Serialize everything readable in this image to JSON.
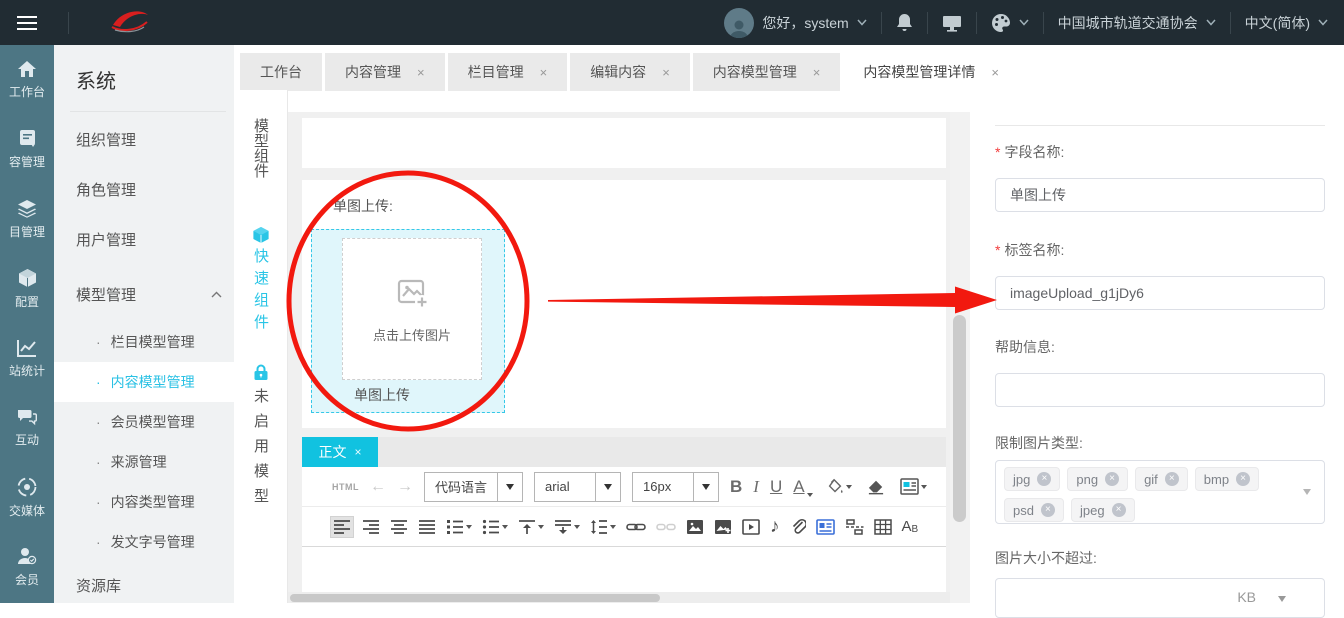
{
  "topbar": {
    "greeting": "您好，system",
    "org_name": "中国城市轨道交通协会",
    "language": "中文(简体)"
  },
  "rail": {
    "items": [
      {
        "label": "工作台",
        "icon": "home-icon"
      },
      {
        "label": "容管理",
        "icon": "document-icon"
      },
      {
        "label": "目管理",
        "icon": "layers-icon"
      },
      {
        "label": "配置",
        "icon": "cube-icon"
      },
      {
        "label": "站统计",
        "icon": "line-chart-icon"
      },
      {
        "label": "互动",
        "icon": "chat-icon"
      },
      {
        "label": "交媒体",
        "icon": "social-icon"
      },
      {
        "label": "会员",
        "icon": "member-icon"
      }
    ]
  },
  "sidebar": {
    "heading": "系统",
    "items": [
      "组织管理",
      "角色管理",
      "用户管理"
    ],
    "group": {
      "label": "模型管理",
      "expanded": true
    },
    "sub_items": [
      {
        "label": "栏目模型管理",
        "active": false
      },
      {
        "label": "内容模型管理",
        "active": true
      },
      {
        "label": "会员模型管理",
        "active": false
      },
      {
        "label": "来源管理",
        "active": false
      },
      {
        "label": "内容类型管理",
        "active": false
      },
      {
        "label": "发文字号管理",
        "active": false
      }
    ],
    "footer_item": "资源库"
  },
  "tabs": [
    {
      "label": "工作台",
      "closable": false,
      "active": false
    },
    {
      "label": "内容管理",
      "closable": true,
      "active": false
    },
    {
      "label": "栏目管理",
      "closable": true,
      "active": false
    },
    {
      "label": "编辑内容",
      "closable": true,
      "active": false
    },
    {
      "label": "内容模型管理",
      "closable": true,
      "active": false
    },
    {
      "label": "内容模型管理详情",
      "closable": true,
      "active": true
    }
  ],
  "component_rail": {
    "groups": [
      "模型组件",
      "快速组件",
      "未启用模型"
    ]
  },
  "form_canvas": {
    "field_label": "单图上传:",
    "upload_hint": "点击上传图片",
    "upload_caption": "单图上传"
  },
  "editor": {
    "tab_label": "正文",
    "html_label": "HTML",
    "selects": {
      "code_language": "代码语言",
      "font": "arial",
      "size": "16px"
    }
  },
  "panel": {
    "fields": {
      "field_name": {
        "label": "字段名称:",
        "required": true,
        "value": "单图上传"
      },
      "tag_name": {
        "label": "标签名称:",
        "required": true,
        "value": "imageUpload_g1jDy6"
      },
      "help_info": {
        "label": "帮助信息:",
        "value": ""
      },
      "image_types": {
        "label": "限制图片类型:",
        "tags": [
          "jpg",
          "png",
          "gif",
          "bmp",
          "psd",
          "jpeg"
        ]
      },
      "max_size": {
        "label": "图片大小不超过:",
        "unit": "KB",
        "value": ""
      }
    }
  },
  "icons": {
    "undo": "←",
    "redo": "→",
    "bold": "B",
    "italic": "I",
    "underline": "U",
    "font_color": "A",
    "music": "♪",
    "case_a": "A",
    "case_b": "B"
  },
  "ui": {
    "close_glyph": "×",
    "bullet": "·",
    "required_mark": "*"
  },
  "colors": {
    "accent_cyan": "#11c2e0",
    "annotation_red": "#f2190f",
    "topbar_bg": "#212c33",
    "rail_bg": "#4d7684"
  }
}
